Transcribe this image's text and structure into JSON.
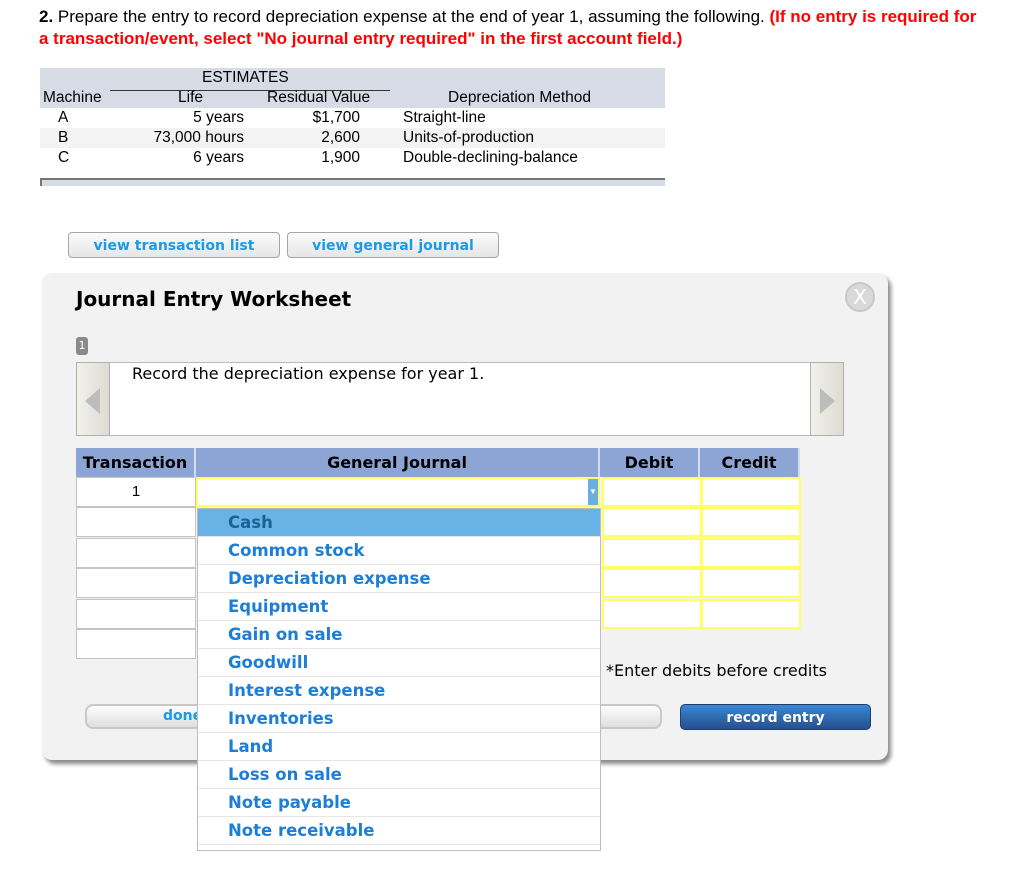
{
  "question": {
    "number": "2.",
    "text": " Prepare the entry to record depreciation expense at the end of year 1, assuming the following. ",
    "instruction": "(If no entry is required for a transaction/event, select \"No journal entry required\" in the first account field.)"
  },
  "estimates_table": {
    "group_header": "ESTIMATES",
    "columns": [
      "Machine",
      "Life",
      "Residual Value",
      "Depreciation Method"
    ],
    "rows": [
      {
        "machine": "A",
        "life": "5 years",
        "residual": "$1,700",
        "method": "Straight-line"
      },
      {
        "machine": "B",
        "life": "73,000 hours",
        "residual": "2,600",
        "method": "Units-of-production"
      },
      {
        "machine": "C",
        "life": "6 years",
        "residual": "1,900",
        "method": "Double-declining-balance"
      }
    ]
  },
  "buttons": {
    "view_transaction_list": "view transaction list",
    "view_general_journal": "view general journal",
    "done": "done",
    "record_entry": "record entry"
  },
  "worksheet": {
    "title": "Journal Entry Worksheet",
    "close_glyph": "X",
    "step_badge": "1",
    "description": "Record the depreciation expense for year 1.",
    "columns": {
      "transaction": "Transaction",
      "general_journal": "General Journal",
      "debit": "Debit",
      "credit": "Credit"
    },
    "rows": [
      {
        "transaction": "1",
        "account": "",
        "debit": "",
        "credit": ""
      },
      {
        "transaction": "",
        "account": "",
        "debit": "",
        "credit": ""
      },
      {
        "transaction": "",
        "account": "",
        "debit": "",
        "credit": ""
      },
      {
        "transaction": "",
        "account": "",
        "debit": "",
        "credit": ""
      },
      {
        "transaction": "",
        "account": "",
        "debit": "",
        "credit": ""
      },
      {
        "transaction": "",
        "account": "",
        "debit": "",
        "credit": ""
      }
    ],
    "note": "*Enter debits before credits"
  },
  "account_dropdown": {
    "highlighted": "Cash",
    "options": [
      "Cash",
      "Common stock",
      "Depreciation expense",
      "Equipment",
      "Gain on sale",
      "Goodwill",
      "Interest expense",
      "Inventories",
      "Land",
      "Loss on sale",
      "Note payable",
      "Note receivable"
    ]
  },
  "colors": {
    "instruction_red": "#ff0000",
    "link_blue": "#1a9be6",
    "header_blue": "#8da5d4",
    "highlight_blue": "#69b2e6",
    "option_blue": "#1d7ed6",
    "input_border_yellow": "#ffff66"
  }
}
